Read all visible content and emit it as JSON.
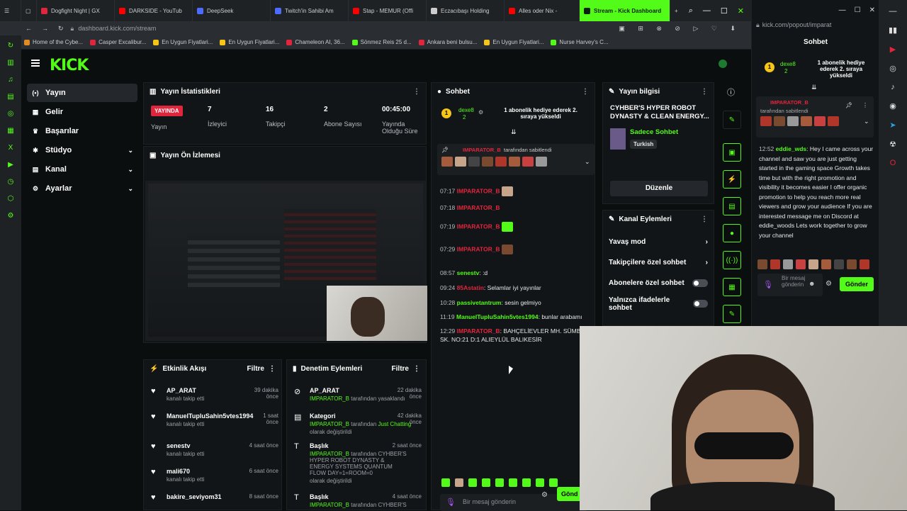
{
  "browser": {
    "tabs": [
      {
        "label": "Dogfight Night | GX",
        "color": "#e1253d"
      },
      {
        "label": "DARKSIDE - YouTub",
        "color": "#ff0000"
      },
      {
        "label": "DeepSeek",
        "color": "#4d6bfe"
      },
      {
        "label": "Twitch'in Sahibi Am",
        "color": "#4d6bfe"
      },
      {
        "label": "Stap - MEMUR (Offi",
        "color": "#ff0000"
      },
      {
        "label": "Eczacıbaşı Holding",
        "color": "#cccccc"
      },
      {
        "label": "Alles oder Nix -",
        "color": "#ff0000"
      },
      {
        "label": "Stream - Kick Dashboard",
        "color": "#08210c"
      }
    ],
    "url": "dashboard.kick.com/stream",
    "bookmarks": [
      "Home of the Cybe...",
      "Casper Excalibur...",
      "En Uygun Fiyatlari...",
      "En Uygun Fiyatlari...",
      "Chameleon AI, 36...",
      "Sönmez Reis 25 d...",
      "Ankara beni bulsu...",
      "En Uygun Fiyatlari...",
      "Nurse Harvey's C..."
    ],
    "popout_url": "kick.com/popout/imparat"
  },
  "app": {
    "logo": "KICK",
    "nav": [
      {
        "label": "Yayın",
        "icon": "broadcast-icon",
        "active": true
      },
      {
        "label": "Gelir",
        "icon": "revenue-icon"
      },
      {
        "label": "Başarılar",
        "icon": "trophy-icon"
      },
      {
        "label": "Stüdyo",
        "icon": "studio-icon",
        "chevron": true
      },
      {
        "label": "Kanal",
        "icon": "channel-icon",
        "chevron": true
      },
      {
        "label": "Ayarlar",
        "icon": "gear-icon",
        "chevron": true
      }
    ]
  },
  "stats": {
    "title": "Yayın İstatistikleri",
    "live_badge": "YAYINDA",
    "live_label": "Yayın",
    "viewers": "7",
    "viewers_label": "İzleyici",
    "followers": "16",
    "followers_label": "Takipçi",
    "subs": "2",
    "subs_label": "Abone Sayısı",
    "duration": "00:45:00",
    "duration_label": "Yayında Olduğu Süre"
  },
  "preview": {
    "title": "Yayın Ön İzlemesi"
  },
  "activity": {
    "title": "Etkinlik Akışı",
    "filter": "Filtre",
    "items": [
      {
        "name": "AP_ARAT",
        "action": "kanalı takip etti",
        "time": "39 dakika önce"
      },
      {
        "name": "ManuelTupluSahin5vtes1994",
        "action": "kanalı takip etti",
        "time": "1 saat önce"
      },
      {
        "name": "senestv",
        "action": "kanalı takip etti",
        "time": "4 saat önce"
      },
      {
        "name": "mali670",
        "action": "kanalı takip etti",
        "time": "6 saat önce"
      },
      {
        "name": "bakire_seviyom31",
        "action": "",
        "time": "8 saat önce"
      }
    ]
  },
  "moderation": {
    "title": "Denetim Eylemleri",
    "filter": "Filtre",
    "items": [
      {
        "name": "AP_ARAT",
        "line2a": "IMPARATOR_B",
        "line2b": "tarafından yasaklandı",
        "time": "22 dakika önce"
      },
      {
        "name": "Kategori",
        "line2a": "IMPARATOR_B",
        "line2b": "tarafından",
        "line2c": "Just Chatting",
        "line3": "olarak değiştirildi",
        "time": "42 dakika önce"
      },
      {
        "name": "Başlık",
        "line2a": "IMPARATOR_B",
        "line2b": "tarafından CYHBER'S HYPER ROBOT DYNASTY & ENERGY SYSTEMS QUANTUM FLOW DAY=1=ROOM=0",
        "line3": "olarak değiştirildi",
        "time": "2 saat önce"
      },
      {
        "name": "Başlık",
        "line2a": "IMPARATOR_B",
        "line2b": "tarafından CYHBER'S",
        "time": "4 saat önce"
      }
    ]
  },
  "chat": {
    "title": "Sohbet",
    "gift_user": "dexe8",
    "gift_count": "2",
    "gift_text": "1 abonelik hediye ederek 2. sıraya yükseldi",
    "pinned_by": "IMPARATOR_B",
    "pinned_label": "tarafından sabitlendi",
    "messages": [
      {
        "time": "07:17",
        "user": "IMPARATOR_B",
        "text": ""
      },
      {
        "time": "07:18",
        "user": "IMPARATOR_B",
        "text": ""
      },
      {
        "time": "07:19",
        "user": "IMPARATOR_B",
        "text": ""
      },
      {
        "time": "07:29",
        "user": "IMPARATOR_B",
        "text": ""
      },
      {
        "time": "08:57",
        "user": "senestv",
        "text": ":d"
      },
      {
        "time": "09:24",
        "user": "85Astatin",
        "text": "Selamlar iyi yayınlar"
      },
      {
        "time": "10:28",
        "user": "passivetantrum",
        "text": "sesin gelmiyo"
      },
      {
        "time": "11:19",
        "user": "ManuelTupluSahin5vtes1994",
        "text": "bunlar arabamı"
      },
      {
        "time": "12:29",
        "user": "IMPARATOR_B",
        "text": "BAHÇELİEVLER MH. SÜMBÜL SK. NO:21 D:1 ALIEYLÜL BALIKESİR"
      }
    ],
    "input_placeholder": "Bir mesaj gönderin",
    "send_label": "Gönd"
  },
  "stream_info": {
    "title": "Yayın bilgisi",
    "stream_title": "CYHBER'S HYPER ROBOT DYNASTY & CLEAN ENERGY...",
    "mode": "Sadece Sohbet",
    "language": "Turkish",
    "edit_button": "Düzenle"
  },
  "channel_actions": {
    "title": "Kanal Eylemleri",
    "items": [
      {
        "label": "Yavaş mod",
        "kind": "chevron"
      },
      {
        "label": "Takipçilere özel sohbet",
        "kind": "chevron"
      },
      {
        "label": "Abonelere özel sohbet",
        "kind": "toggle"
      },
      {
        "label": "Yalnızca ifadelerle sohbet",
        "kind": "toggle"
      }
    ]
  },
  "popout": {
    "title": "Sohbet",
    "gift_user": "dexe8",
    "gift_count": "2",
    "gift_text": "1 abonelik hediye ederek 2. sıraya yükseldi",
    "pinned_by": "IMPARATOR_B",
    "pinned_label": "tarafından sabitlendi",
    "message_time": "12:52",
    "message_user": "eddie_wds",
    "message_text": "Hey I came across your channel and saw you are just getting started in the gaming space Growth takes time but with the right promotion and visibility it becomes easier I offer organic promotion to help you reach more real viewers and grow your audience If you are interested message me on Discord at eddie_woods Lets work together to grow your channel",
    "input_placeholder": "Bir mesaj gönderin",
    "send_label": "Gönder"
  },
  "colors": {
    "accent": "#53fc18",
    "live": "#e1253d",
    "panel": "#121517",
    "bg": "#0b0e0f"
  }
}
